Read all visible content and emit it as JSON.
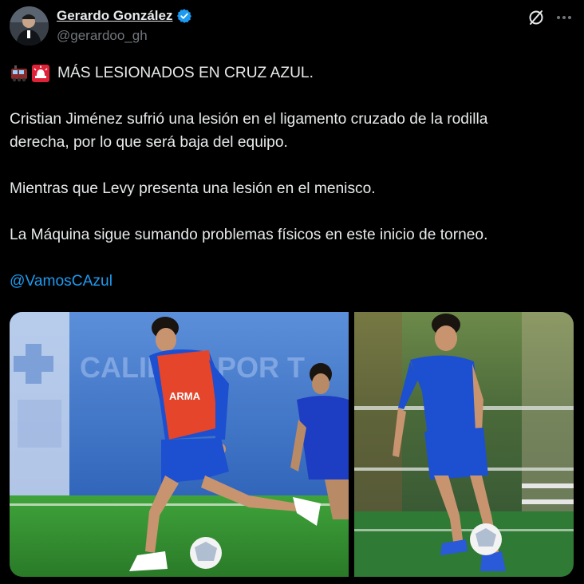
{
  "author": {
    "name": "Gerardo González",
    "handle": "@gerardoo_gh"
  },
  "icons": {
    "avatar": "profile-photo",
    "verified": "verified-badge-icon",
    "grok": "grok-icon",
    "more": "more-options-icon",
    "emoji_1": "train-emoji",
    "emoji_2": "rotating-light-emoji"
  },
  "tweet": {
    "headline": "MÁS LESIONADOS EN CRUZ AZUL.",
    "paragraph_1_line_1": "Cristian Jiménez sufrió una lesión en el ligamento cruzado de la rodilla",
    "paragraph_1_line_2": "derecha, por lo que será baja del equipo.",
    "paragraph_2": "Mientras que Levy presenta una lesión en el menisco.",
    "paragraph_3": "La Máquina sigue sumando problemas físicos en este inicio de torneo.",
    "mention": "@VamosCAzul"
  },
  "media": {
    "photo_1": {
      "banner_text": "CALIDAD POR T",
      "bib_text": "ARMA"
    },
    "photo_2": {}
  },
  "colors": {
    "background": "#000000",
    "text": "#e7e9ea",
    "secondary": "#71767b",
    "link": "#1d9bf0",
    "verified": "#1d9bf0"
  }
}
